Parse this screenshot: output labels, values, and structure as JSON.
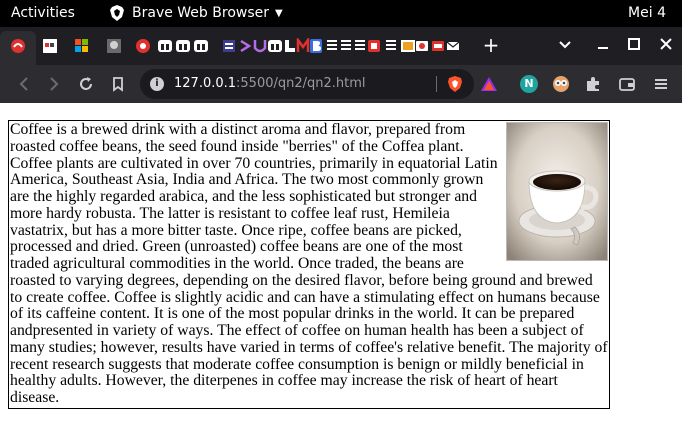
{
  "topbar": {
    "activities_label": "Activities",
    "app_name": "Brave Web Browser",
    "clock": "Mei 4"
  },
  "tabs": {
    "new_tab_label": "+"
  },
  "toolbar": {
    "url_host": "127.0.0.1",
    "url_rest": ":5500/qn2/qn2.html",
    "profile_initial": "N"
  },
  "article": {
    "text": "Coffee is a brewed drink with a distinct aroma and flavor, prepared from roasted coffee beans, the seed found inside \"berries\" of the Coffea plant. Coffee plants are cultivated in over 70 countries, primarily in equatorial Latin America, Southeast Asia, India and Africa. The two most commonly grown are the highly regarded arabica, and the less sophisticated but stronger and more hardy robusta. The latter is resistant to coffee leaf rust, Hemileia vastatrix, but has a more bitter taste. Once ripe, coffee beans are picked, processed and dried. Green (unroasted) coffee beans are one of the most traded agricultural commodities in the world. Once traded, the beans are roasted to varying degrees, depending on the desired flavor, before being ground and brewed to create coffee. Coffee is slightly acidic and can have a stimulating effect on humans because of its caffeine content. It is one of the most popular drinks in the world. It can be prepared andpresented in variety of ways. The effect of coffee on human health has been a subject of many studies; however, results have varied in terms of coffee's relative benefit. The majority of recent research suggests that moderate coffee consumption is benign or mildly beneficial in healthy adults. However, the diterpenes in coffee may increase the risk of heart of heart disease."
  },
  "icons": {
    "photo": "coffee-cup-photo",
    "info": "site-info-icon",
    "brave": "brave-shields-icon",
    "rewards": "brave-rewards-icon"
  },
  "colors": {
    "topbar": "#000000",
    "tabstrip": "#1f1f23",
    "toolbar": "#2d2d31",
    "urlbar": "#1b1b1f",
    "brave_orange": "#fb542b"
  }
}
